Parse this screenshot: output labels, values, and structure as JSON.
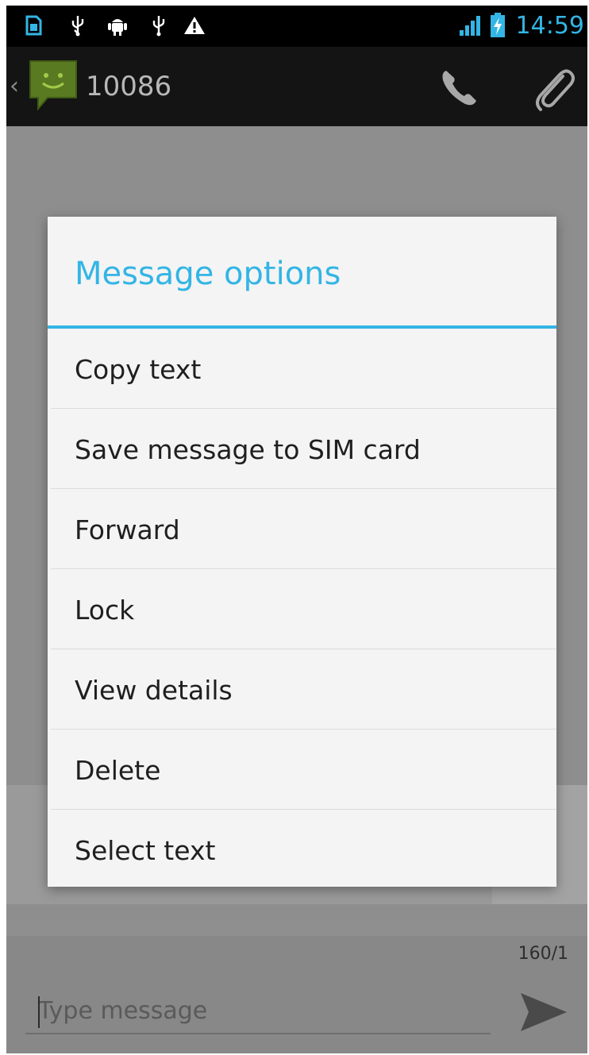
{
  "status_bar": {
    "time": "14:59",
    "icons": [
      "sim-card-icon",
      "usb-icon",
      "android-debug-icon",
      "usb-icon",
      "warning-icon",
      "signal-icon",
      "battery-charging-icon"
    ],
    "accent_color": "#33b5e5"
  },
  "action_bar": {
    "contact": "10086",
    "icons": [
      "back-chevron-icon",
      "messaging-app-icon",
      "phone-icon",
      "paperclip-icon"
    ]
  },
  "dialog": {
    "title": "Message options",
    "title_color": "#33b5e5",
    "items": [
      {
        "label": "Copy text"
      },
      {
        "label": "Save message to SIM card"
      },
      {
        "label": "Forward"
      },
      {
        "label": "Lock"
      },
      {
        "label": "View details"
      },
      {
        "label": "Delete"
      },
      {
        "label": "Select text"
      }
    ]
  },
  "compose": {
    "counter": "160/1",
    "placeholder": "Type message",
    "send_icon": "send-icon"
  }
}
